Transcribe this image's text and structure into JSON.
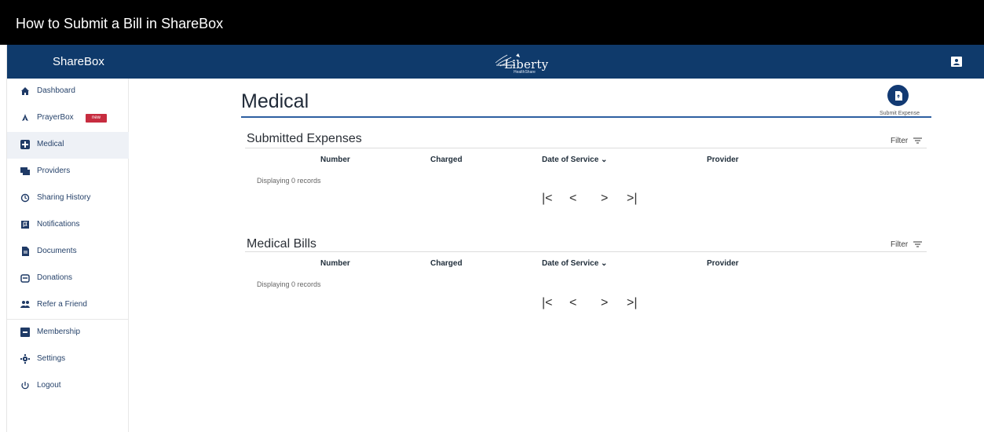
{
  "video": {
    "title": "How to Submit a Bill in ShareBox"
  },
  "topbar": {
    "brand": "ShareBox",
    "logo": {
      "title": "Liberty",
      "subtitle": "HealthShare"
    },
    "user_icon": "user-card-icon"
  },
  "sidebar": {
    "items": [
      {
        "label": "Dashboard",
        "icon": "home-icon"
      },
      {
        "label": "PrayerBox",
        "icon": "prayer-hands-icon",
        "badge": "new"
      },
      {
        "label": "Medical",
        "icon": "medical-plus-icon",
        "active": true
      },
      {
        "label": "Providers",
        "icon": "providers-icon"
      },
      {
        "label": "Sharing History",
        "icon": "history-icon"
      },
      {
        "label": "Notifications",
        "icon": "notification-flag-icon"
      },
      {
        "label": "Documents",
        "icon": "document-icon"
      },
      {
        "label": "Donations",
        "icon": "donation-box-icon"
      },
      {
        "label": "Refer a Friend",
        "icon": "friends-icon"
      },
      {
        "label": "Membership",
        "icon": "membership-card-icon"
      },
      {
        "label": "Settings",
        "icon": "gear-icon"
      },
      {
        "label": "Logout",
        "icon": "power-icon"
      }
    ]
  },
  "main": {
    "title": "Medical",
    "submit_label": "Submit Expense",
    "sections": [
      {
        "title": "Submitted Expenses",
        "filter_label": "Filter",
        "columns": [
          "Number",
          "Charged",
          "Date of Service",
          "Provider"
        ],
        "records_text": "Displaying 0 records",
        "pager": [
          "|<",
          "<",
          ">",
          ">|"
        ]
      },
      {
        "title": "Medical Bills",
        "filter_label": "Filter",
        "columns": [
          "Number",
          "Charged",
          "Date of Service",
          "Provider"
        ],
        "records_text": "Displaying 0 records",
        "pager": [
          "|<",
          "<",
          ">",
          ">|"
        ]
      }
    ]
  },
  "colors": {
    "header": "#0f3a6b",
    "accent": "#2d5fa1",
    "badge": "#c72c3f",
    "active_bg": "#eef1f6"
  }
}
